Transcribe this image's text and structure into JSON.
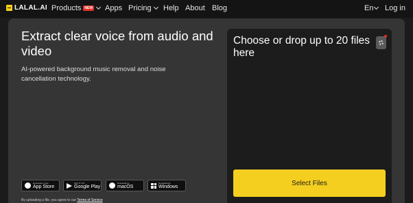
{
  "nav": {
    "logo_text": "LALAL.AI",
    "products": "Products",
    "products_badge": "NEW",
    "apps": "Apps",
    "pricing": "Pricing",
    "help": "Help",
    "about": "About",
    "blog": "Blog",
    "language": "En",
    "login": "Log in"
  },
  "hero": {
    "headline": "Extract clear voice from audio and video",
    "subtext": "AI-powered background music removal and noise cancellation technology."
  },
  "stores": [
    {
      "small": "Download on the",
      "big": "App Store",
      "icon": "apple-icon"
    },
    {
      "small": "GET IT ON",
      "big": "Google Play",
      "icon": "google-play-icon"
    },
    {
      "small": "Download for",
      "big": "macOS",
      "icon": "macos-icon"
    },
    {
      "small": "Download for",
      "big": "Windows",
      "icon": "windows-icon"
    }
  ],
  "disclaimer": {
    "prefix": "By uploading a file, you agree to our",
    "link": "Terms of Service"
  },
  "upload": {
    "title": "Choose or drop up to 20 files here",
    "button": "Select Files"
  },
  "colors": {
    "accent": "#f5cf1f",
    "badge": "#e0322a",
    "panel": "#353535",
    "dropzone": "#1c1c1c"
  }
}
